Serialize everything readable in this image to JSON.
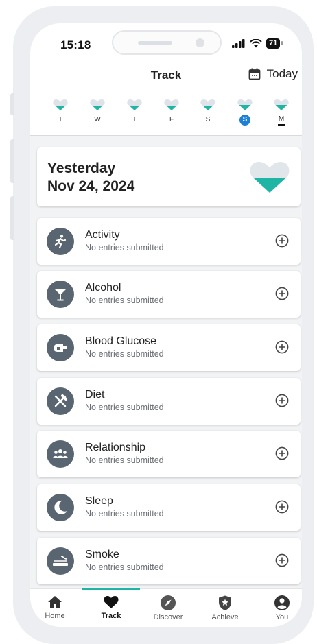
{
  "status_bar": {
    "time": "15:18",
    "battery": "71"
  },
  "header": {
    "title": "Track",
    "today_label": "Today"
  },
  "week": {
    "days": [
      {
        "label": "T",
        "state": "empty"
      },
      {
        "label": "W",
        "state": "empty"
      },
      {
        "label": "T",
        "state": "empty"
      },
      {
        "label": "F",
        "state": "empty"
      },
      {
        "label": "S",
        "state": "empty"
      },
      {
        "label": "S",
        "state": "selected"
      },
      {
        "label": "M",
        "state": "current"
      }
    ]
  },
  "day_card": {
    "title": "Yesterday",
    "date": "Nov 24, 2024"
  },
  "trackers": [
    {
      "title": "Activity",
      "subtitle": "No entries submitted",
      "icon": "running-person-icon"
    },
    {
      "title": "Alcohol",
      "subtitle": "No entries submitted",
      "icon": "cocktail-glass-icon"
    },
    {
      "title": "Blood Glucose",
      "subtitle": "No entries submitted",
      "icon": "glucose-meter-icon"
    },
    {
      "title": "Diet",
      "subtitle": "No entries submitted",
      "icon": "fork-knife-icon"
    },
    {
      "title": "Relationship",
      "subtitle": "No entries submitted",
      "icon": "people-group-icon"
    },
    {
      "title": "Sleep",
      "subtitle": "No entries submitted",
      "icon": "moon-icon"
    },
    {
      "title": "Smoke",
      "subtitle": "No entries submitted",
      "icon": "cigarette-icon"
    }
  ],
  "tabs": [
    {
      "label": "Home",
      "icon": "home-icon"
    },
    {
      "label": "Track",
      "icon": "heart-icon",
      "active": true
    },
    {
      "label": "Discover",
      "icon": "compass-icon"
    },
    {
      "label": "Achieve",
      "icon": "star-shield-icon"
    },
    {
      "label": "You",
      "icon": "user-icon"
    }
  ],
  "colors": {
    "accent_teal": "#1fb5a4",
    "selected_blue": "#1e7fd6",
    "icon_gray": "#5a6572",
    "heart_empty": "#dde3e8"
  }
}
